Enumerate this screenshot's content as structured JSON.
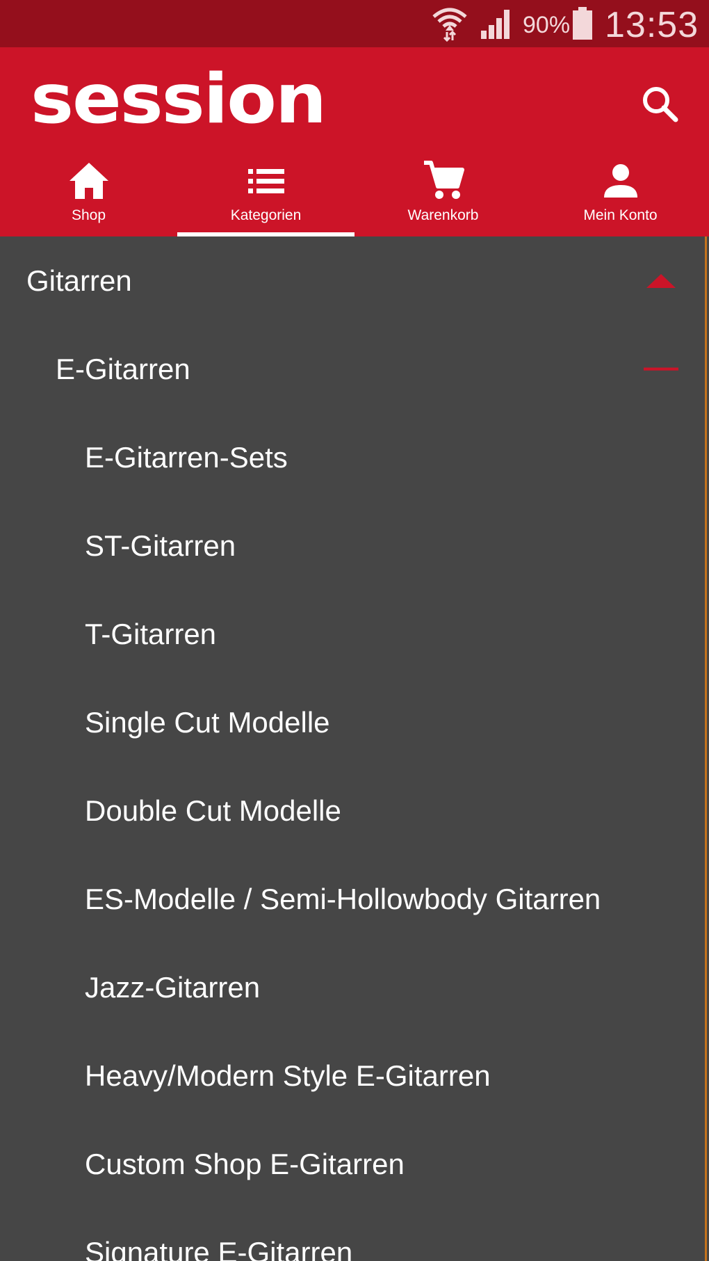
{
  "status_bar": {
    "battery_percent": "90%",
    "time": "13:53",
    "wifi_icon": "wifi-icon",
    "signal_icon": "cell-signal-icon",
    "battery_icon": "battery-icon"
  },
  "header": {
    "logo_text": "session",
    "search_icon": "search-icon",
    "brand_color": "#cc1428",
    "status_color": "#940f1c"
  },
  "tabs": [
    {
      "label": "Shop",
      "icon": "home-icon",
      "active": false
    },
    {
      "label": "Kategorien",
      "icon": "list-icon",
      "active": true
    },
    {
      "label": "Warenkorb",
      "icon": "cart-icon",
      "active": false
    },
    {
      "label": "Mein Konto",
      "icon": "person-icon",
      "active": false
    }
  ],
  "categories": {
    "level1": {
      "label": "Gitarren",
      "toggle_icon": "triangle-up-icon",
      "expanded": true
    },
    "level2": {
      "label": "E-Gitarren",
      "toggle_icon": "minus-icon",
      "expanded": true
    },
    "items": [
      {
        "label": "E-Gitarren-Sets"
      },
      {
        "label": "ST-Gitarren"
      },
      {
        "label": "T-Gitarren"
      },
      {
        "label": "Single Cut Modelle"
      },
      {
        "label": "Double Cut Modelle"
      },
      {
        "label": "ES-Modelle / Semi-Hollowbody Gitarren"
      },
      {
        "label": "Jazz-Gitarren"
      },
      {
        "label": "Heavy/Modern Style E-Gitarren"
      },
      {
        "label": "Custom Shop E-Gitarren"
      },
      {
        "label": "Signature E-Gitarren"
      }
    ],
    "accent_color": "#cc1428",
    "background_color": "#464646"
  }
}
